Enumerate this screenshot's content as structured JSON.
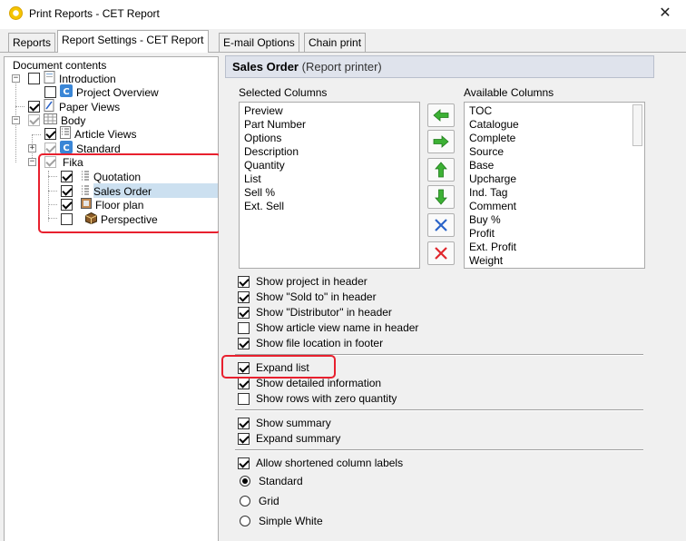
{
  "window": {
    "title": "Print Reports - CET Report",
    "close_glyph": "✕"
  },
  "tabs": [
    {
      "label": "Reports",
      "active": false
    },
    {
      "label": "Report Settings - CET Report",
      "active": true
    },
    {
      "label": "E-mail Options",
      "active": false
    },
    {
      "label": "Chain print",
      "active": false
    }
  ],
  "tree": {
    "root_label": "Document contents",
    "items": [
      {
        "label": "Introduction",
        "checked": false,
        "icon": "document-icon"
      },
      {
        "label": "Project Overview",
        "checked": false,
        "icon": "cet-logo-icon"
      },
      {
        "label": "Paper Views",
        "checked": true,
        "icon": "paper-view-icon"
      },
      {
        "label": "Body",
        "checked": true,
        "icon": "body-grid-icon"
      },
      {
        "label": "Article Views",
        "checked": true,
        "icon": "list-document-icon"
      },
      {
        "label": "Standard",
        "checked": true,
        "icon": "cet-logo-icon"
      },
      {
        "label": "Fika",
        "checked": true,
        "icon": "none"
      },
      {
        "label": "Quotation",
        "checked": true,
        "icon": "list-document-icon"
      },
      {
        "label": "Sales Order",
        "checked": true,
        "icon": "list-document-icon",
        "selected": true
      },
      {
        "label": "Floor plan",
        "checked": true,
        "icon": "floor-plan-icon"
      },
      {
        "label": "Perspective",
        "checked": false,
        "icon": "cube-icon"
      }
    ]
  },
  "panel": {
    "title": "Sales Order",
    "subtitle": "(Report printer)",
    "selected_columns_label": "Selected Columns",
    "available_columns_label": "Available Columns",
    "selected_columns": [
      "Preview",
      "Part Number",
      "Options",
      "Description",
      "Quantity",
      "List",
      "Sell %",
      "Ext. Sell"
    ],
    "available_columns": [
      "TOC",
      "Catalogue",
      "Complete",
      "Source",
      "Base",
      "Upcharge",
      "Ind. Tag",
      "Comment",
      "Buy %",
      "Profit",
      "Ext. Profit",
      "Weight"
    ],
    "options_group1": [
      {
        "label": "Show project in header",
        "checked": true
      },
      {
        "label": "Show \"Sold to\" in header",
        "checked": true
      },
      {
        "label": "Show \"Distributor\" in header",
        "checked": true
      },
      {
        "label": "Show article view name in header",
        "checked": false
      },
      {
        "label": "Show file location in footer",
        "checked": true
      }
    ],
    "options_group2": [
      {
        "label": "Expand list",
        "checked": true
      },
      {
        "label": "Show detailed information",
        "checked": true
      },
      {
        "label": "Show rows with zero quantity",
        "checked": false
      }
    ],
    "options_group3": [
      {
        "label": "Show summary",
        "checked": true
      },
      {
        "label": "Expand summary",
        "checked": true
      }
    ],
    "options_group4": [
      {
        "label": "Allow shortened column labels",
        "checked": true
      }
    ],
    "styles": [
      {
        "label": "Standard",
        "selected": true
      },
      {
        "label": "Grid",
        "selected": false
      },
      {
        "label": "Simple White",
        "selected": false
      }
    ]
  },
  "colors": {
    "green_arrow": "#3cb034",
    "blue_x": "#2a63c8",
    "red_x": "#e0262c",
    "highlight": "#e8202e"
  }
}
